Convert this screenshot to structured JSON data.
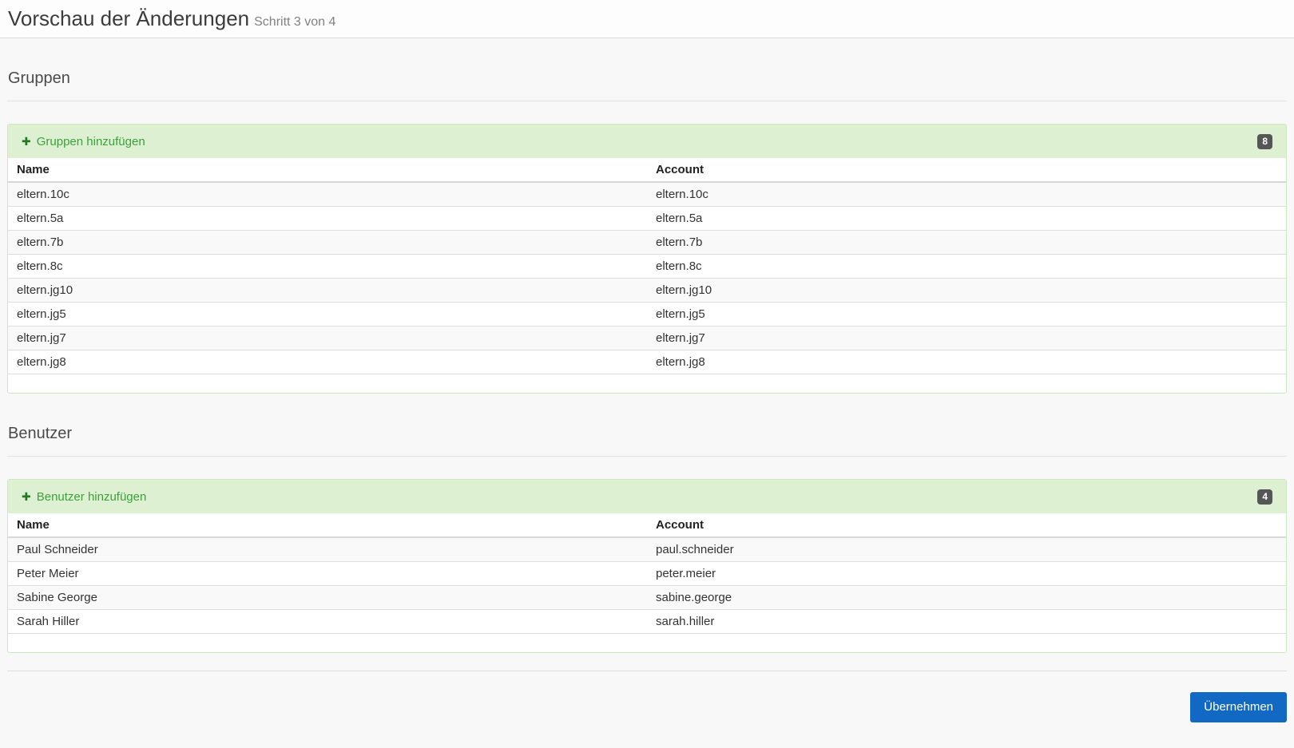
{
  "page": {
    "title": "Vorschau der Änderungen",
    "step_indicator": "Schritt 3 von 4",
    "apply_button_label": "Übernehmen"
  },
  "icons": {
    "plus_icon": "✚"
  },
  "colors": {
    "accent_green_text": "#3da13a",
    "panel_header_bg": "#ddf0d2",
    "panel_border": "#cfe7c1",
    "badge_bg": "#565656",
    "button_bg": "#1269c4",
    "page_bg": "#f8f8f8"
  },
  "sections": [
    {
      "heading": "Gruppen",
      "add_label": "Gruppen hinzufügen",
      "count": "8",
      "columns": [
        "Name",
        "Account"
      ],
      "rows": [
        [
          "eltern.10c",
          "eltern.10c"
        ],
        [
          "eltern.5a",
          "eltern.5a"
        ],
        [
          "eltern.7b",
          "eltern.7b"
        ],
        [
          "eltern.8c",
          "eltern.8c"
        ],
        [
          "eltern.jg10",
          "eltern.jg10"
        ],
        [
          "eltern.jg5",
          "eltern.jg5"
        ],
        [
          "eltern.jg7",
          "eltern.jg7"
        ],
        [
          "eltern.jg8",
          "eltern.jg8"
        ]
      ]
    },
    {
      "heading": "Benutzer",
      "add_label": "Benutzer hinzufügen",
      "count": "4",
      "columns": [
        "Name",
        "Account"
      ],
      "rows": [
        [
          "Paul Schneider",
          "paul.schneider"
        ],
        [
          "Peter Meier",
          "peter.meier"
        ],
        [
          "Sabine George",
          "sabine.george"
        ],
        [
          "Sarah Hiller",
          "sarah.hiller"
        ]
      ]
    }
  ]
}
